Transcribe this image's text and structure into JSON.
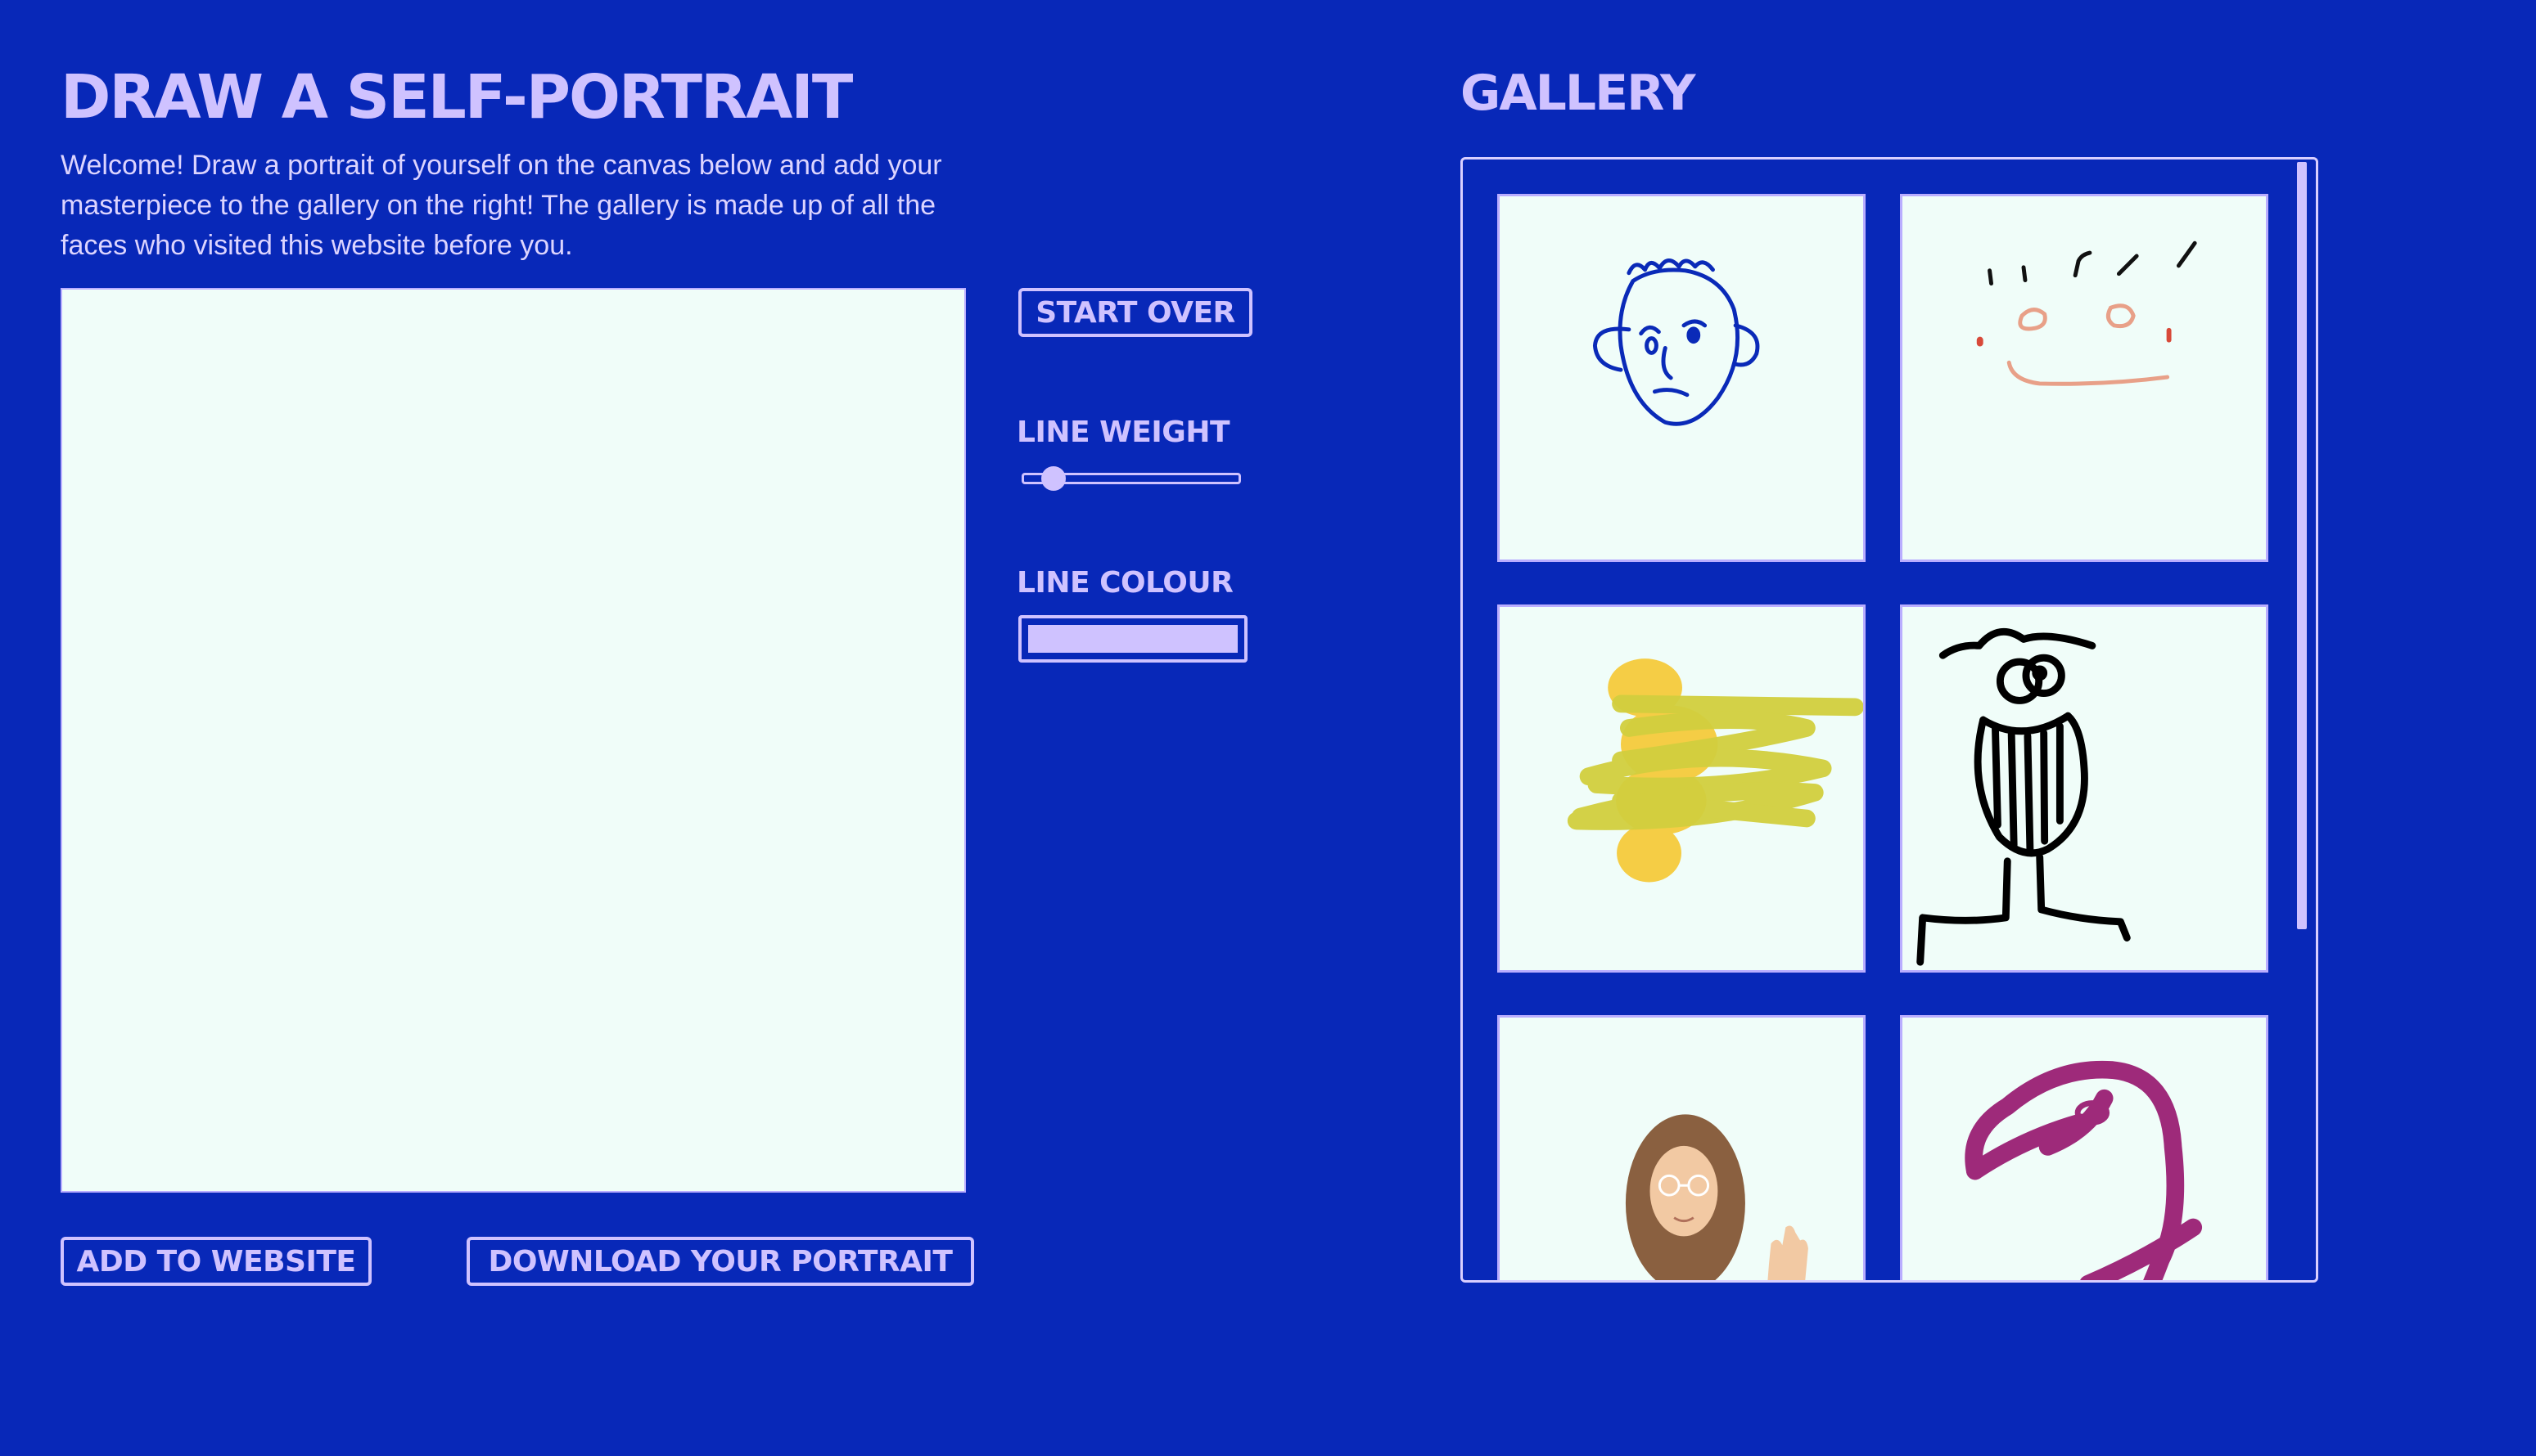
{
  "page": {
    "title": "DRAW A SELF-PORTRAIT",
    "intro": "Welcome! Draw a portrait of yourself on the canvas below and add your masterpiece to the gallery on the right! The gallery is made up of all the faces who visited this website before you."
  },
  "controls": {
    "start_over": "START OVER",
    "line_weight_label": "LINE WEIGHT",
    "line_weight_value": 0.1,
    "line_colour_label": "LINE COLOUR",
    "line_colour": "#cfc2ff"
  },
  "actions": {
    "add": "ADD TO WEBSITE",
    "download": "DOWNLOAD YOUR PORTRAIT"
  },
  "gallery": {
    "title": "GALLERY",
    "items": [
      {
        "icon": "blue-line-face-drawing",
        "color": "#0a2ab8"
      },
      {
        "icon": "sparse-smile-face-drawing",
        "color": "#e8a088"
      },
      {
        "icon": "yellow-scribble-drawing",
        "color": "#d2cf3e"
      },
      {
        "icon": "grinning-stick-figure-drawing",
        "color": "#000000"
      },
      {
        "icon": "waving-person-illustration",
        "color": "#8a6040"
      },
      {
        "icon": "purple-bird-drawing",
        "color": "#9e2a7a"
      }
    ]
  },
  "theme": {
    "background": "#0828b8",
    "accent": "#cfc2ff",
    "canvas": "#f0fdf9"
  }
}
